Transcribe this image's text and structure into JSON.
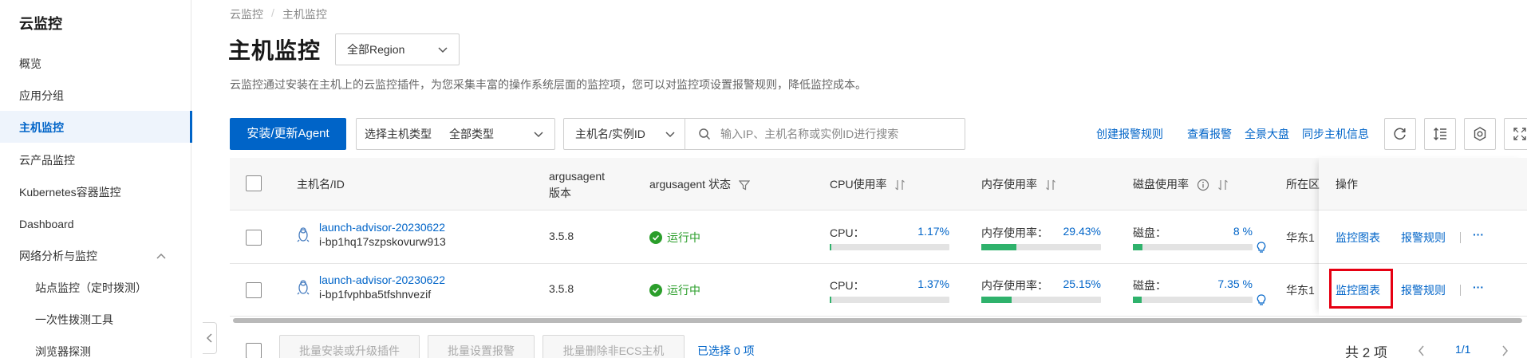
{
  "sidebar": {
    "title": "云监控",
    "items": [
      {
        "label": "概览"
      },
      {
        "label": "应用分组"
      },
      {
        "label": "主机监控"
      },
      {
        "label": "云产品监控"
      },
      {
        "label": "Kubernetes容器监控"
      },
      {
        "label": "Dashboard"
      },
      {
        "label": "网络分析与监控"
      },
      {
        "label": "站点监控（定时拨测）"
      },
      {
        "label": "一次性拨测工具"
      },
      {
        "label": "浏览器探测"
      }
    ]
  },
  "breadcrumb": {
    "root": "云监控",
    "sep": "/",
    "current": "主机监控"
  },
  "page": {
    "title": "主机监控",
    "region": "全部Region",
    "description": "云监控通过安装在主机上的云监控插件，为您采集丰富的操作系统层面的监控项，您可以对监控项设置报警规则，降低监控成本。"
  },
  "toolbar": {
    "install_button": "安装/更新Agent",
    "type_label": "选择主机类型",
    "type_value": "全部类型",
    "search_key": "主机名/实例ID",
    "search_placeholder": "输入IP、主机名称或实例ID进行搜索",
    "links": [
      "创建报警规则",
      "查看报警",
      "全景大盘",
      "同步主机信息"
    ]
  },
  "table": {
    "headers": {
      "host": "主机名/ID",
      "agent_version_1": "argusagent",
      "agent_version_2": "版本",
      "agent_status": "argusagent 状态",
      "cpu": "CPU使用率",
      "mem": "内存使用率",
      "disk": "磁盘使用率",
      "region": "所在区",
      "ops": "操作"
    },
    "rows": [
      {
        "host_name": "launch-advisor-20230622",
        "host_id": "i-bp1hq17szpskovurw913",
        "version": "3.5.8",
        "status": "运行中",
        "cpu_label": "CPU：",
        "cpu_value": "1.17%",
        "cpu_pct": 1.17,
        "mem_label": "内存使用率：",
        "mem_value": "29.43%",
        "mem_pct": 29.43,
        "disk_label": "磁盘：",
        "disk_value": "8 %",
        "disk_pct": 8,
        "region": "华东1",
        "op1": "监控图表",
        "op2": "报警规则",
        "more": "···"
      },
      {
        "host_name": "launch-advisor-20230622",
        "host_id": "i-bp1fvphba5tfshnvezif",
        "version": "3.5.8",
        "status": "运行中",
        "cpu_label": "CPU：",
        "cpu_value": "1.37%",
        "cpu_pct": 1.37,
        "mem_label": "内存使用率：",
        "mem_value": "25.15%",
        "mem_pct": 25.15,
        "disk_label": "磁盘：",
        "disk_value": "7.35 %",
        "disk_pct": 7.35,
        "region": "华东1",
        "op1": "监控图表",
        "op2": "报警规则",
        "more": "···"
      }
    ]
  },
  "footer": {
    "batch_install": "批量安装或升级插件",
    "batch_alarm": "批量设置报警",
    "batch_delete": "批量删除非ECS主机",
    "selected": "已选择 0 项",
    "total": "共 2 项",
    "page": "1/1"
  },
  "colors": {
    "primary": "#0064c8",
    "success": "#2b9e2b",
    "bar_fill": "#2fb26c",
    "highlight": "#e60012"
  }
}
